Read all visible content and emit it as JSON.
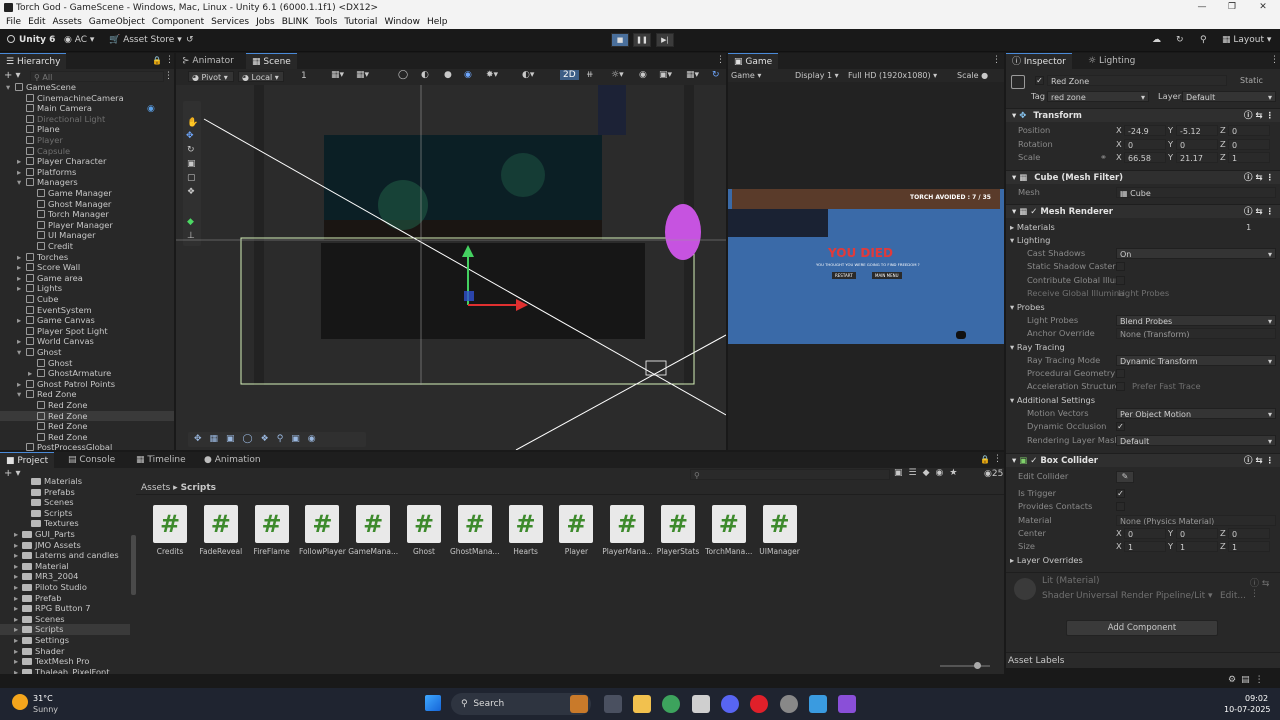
{
  "window": {
    "title": "Torch God - GameScene - Windows, Mac, Linux - Unity 6.1 (6000.1.1f1) <DX12>"
  },
  "menu": [
    "File",
    "Edit",
    "Assets",
    "GameObject",
    "Component",
    "Services",
    "Jobs",
    "BLINK",
    "Tools",
    "Tutorial",
    "Window",
    "Help"
  ],
  "toolbar": {
    "unity": "Unity 6",
    "account": "AC",
    "asset_store": "Asset Store",
    "layout": "Layout"
  },
  "hierarchy": {
    "title": "Hierarchy",
    "search_placeholder": "All",
    "items": [
      {
        "label": "GameScene",
        "depth": 0,
        "style": "scene",
        "arrow": "open"
      },
      {
        "label": "CinemachineCamera",
        "depth": 1
      },
      {
        "label": "Main Camera",
        "depth": 1
      },
      {
        "label": "Directional Light",
        "depth": 1,
        "style": "dim"
      },
      {
        "label": "Plane",
        "depth": 1
      },
      {
        "label": "Player",
        "depth": 1,
        "style": "dim"
      },
      {
        "label": "Capsule",
        "depth": 1,
        "style": "dim"
      },
      {
        "label": "Player Character",
        "depth": 1,
        "arrow": "closed"
      },
      {
        "label": "Platforms",
        "depth": 1,
        "arrow": "closed"
      },
      {
        "label": "Managers",
        "depth": 1,
        "arrow": "open"
      },
      {
        "label": "Game Manager",
        "depth": 2
      },
      {
        "label": "Ghost Manager",
        "depth": 2
      },
      {
        "label": "Torch Manager",
        "depth": 2
      },
      {
        "label": "Player Manager",
        "depth": 2
      },
      {
        "label": "UI Manager",
        "depth": 2
      },
      {
        "label": "Credit",
        "depth": 2
      },
      {
        "label": "Torches",
        "depth": 1,
        "arrow": "closed"
      },
      {
        "label": "Score Wall",
        "depth": 1,
        "arrow": "closed"
      },
      {
        "label": "Game area",
        "depth": 1,
        "arrow": "closed"
      },
      {
        "label": "Lights",
        "depth": 1,
        "arrow": "closed"
      },
      {
        "label": "Cube",
        "depth": 1
      },
      {
        "label": "EventSystem",
        "depth": 1
      },
      {
        "label": "Game Canvas",
        "depth": 1,
        "arrow": "closed"
      },
      {
        "label": "Player Spot Light",
        "depth": 1
      },
      {
        "label": "World Canvas",
        "depth": 1,
        "arrow": "closed"
      },
      {
        "label": "Ghost",
        "depth": 1,
        "arrow": "open"
      },
      {
        "label": "Ghost",
        "depth": 2
      },
      {
        "label": "GhostArmature",
        "depth": 2,
        "arrow": "closed"
      },
      {
        "label": "Ghost Patrol Points",
        "depth": 1,
        "arrow": "closed"
      },
      {
        "label": "Red Zone",
        "depth": 1,
        "arrow": "open"
      },
      {
        "label": "Red Zone",
        "depth": 2
      },
      {
        "label": "Red Zone",
        "depth": 2,
        "style": "sel"
      },
      {
        "label": "Red Zone",
        "depth": 2
      },
      {
        "label": "Red Zone",
        "depth": 2
      },
      {
        "label": "PostProcessGlobal",
        "depth": 1
      }
    ]
  },
  "scene": {
    "tabs": [
      "Animator",
      "Scene"
    ],
    "pivot": "Pivot",
    "local": "Local",
    "snap": "1",
    "mode2d": "2D"
  },
  "game": {
    "tab": "Game",
    "display_mode": "Game",
    "display": "Display 1",
    "resolution": "Full HD (1920x1080)",
    "scale": "Scale",
    "hud": "TORCH AVOIDED : 7 / 35",
    "died_title": "YOU DIED",
    "died_sub": "YOU THOUGHT YOU WERE GOING TO FIND FREEDOM ?",
    "restart": "RESTART",
    "main_menu": "MAIN MENU"
  },
  "inspector": {
    "tabs": [
      "Inspector",
      "Lighting"
    ],
    "name": "Red Zone",
    "static": "Static",
    "tag_label": "Tag",
    "tag": "red zone",
    "layer_label": "Layer",
    "layer": "Default",
    "transform": {
      "title": "Transform",
      "position": [
        "-24.9",
        "-5.12",
        "0"
      ],
      "rotation": [
        "0",
        "0",
        "0"
      ],
      "scale": [
        "66.58",
        "21.17",
        "1"
      ],
      "labels": [
        "Position",
        "Rotation",
        "Scale"
      ]
    },
    "mesh_filter": {
      "title": "Cube (Mesh Filter)",
      "mesh_label": "Mesh",
      "mesh": "Cube"
    },
    "mesh_renderer": {
      "title": "Mesh Renderer",
      "materials": "Materials",
      "materials_count": "1",
      "lighting": "Lighting",
      "cast_shadows_label": "Cast Shadows",
      "cast_shadows": "On",
      "static_shadow": "Static Shadow Caster",
      "contribute_gi": "Contribute Global Illum",
      "receive_gi_label": "Receive Global Illumina",
      "receive_gi": "Light Probes",
      "probes": "Probes",
      "light_probes_label": "Light Probes",
      "light_probes": "Blend Probes",
      "anchor_label": "Anchor Override",
      "anchor": "None (Transform)",
      "ray_tracing": "Ray Tracing",
      "rt_mode_label": "Ray Tracing Mode",
      "rt_mode": "Dynamic Transform",
      "procedural": "Procedural Geometry",
      "accel_label": "Acceleration Structure",
      "accel": "Prefer Fast Trace",
      "additional": "Additional Settings",
      "motion_label": "Motion Vectors",
      "motion": "Per Object Motion",
      "dyn_occ": "Dynamic Occlusion",
      "rlm_label": "Rendering Layer Mask",
      "rlm": "Default"
    },
    "box_collider": {
      "title": "Box Collider",
      "edit": "Edit Collider",
      "is_trigger": "Is Trigger",
      "provides": "Provides Contacts",
      "material_label": "Material",
      "material": "None (Physics Material)",
      "center_label": "Center",
      "center": [
        "0",
        "0",
        "0"
      ],
      "size_label": "Size",
      "size": [
        "1",
        "1",
        "1"
      ],
      "overrides": "Layer Overrides"
    },
    "material": {
      "name": "Lit (Material)",
      "shader_label": "Shader",
      "shader": "Universal Render Pipeline/Lit",
      "edit": "Edit..."
    },
    "add_component": "Add Component",
    "asset_labels": "Asset Labels"
  },
  "bottom": {
    "tabs": [
      "Project",
      "Console",
      "Timeline",
      "Animation"
    ],
    "breadcrumb": [
      "Assets",
      "Scripts"
    ],
    "count": "25",
    "folders": [
      {
        "label": "Materials",
        "depth": 2
      },
      {
        "label": "Prefabs",
        "depth": 2
      },
      {
        "label": "Scenes",
        "depth": 2
      },
      {
        "label": "Scripts",
        "depth": 2
      },
      {
        "label": "Textures",
        "depth": 2
      },
      {
        "label": "GUI_Parts",
        "depth": 1
      },
      {
        "label": "JMO Assets",
        "depth": 1
      },
      {
        "label": "Laterns and candles",
        "depth": 1
      },
      {
        "label": "Material",
        "depth": 1
      },
      {
        "label": "MR3_2004",
        "depth": 1
      },
      {
        "label": "Piloto Studio",
        "depth": 1
      },
      {
        "label": "Prefab",
        "depth": 1
      },
      {
        "label": "RPG Button 7",
        "depth": 1
      },
      {
        "label": "Scenes",
        "depth": 1
      },
      {
        "label": "Scripts",
        "depth": 1,
        "sel": true
      },
      {
        "label": "Settings",
        "depth": 1
      },
      {
        "label": "Shader",
        "depth": 1
      },
      {
        "label": "TextMesh Pro",
        "depth": 1
      },
      {
        "label": "Thaleah_PixelFont",
        "depth": 1
      }
    ],
    "scripts": [
      "Credits",
      "FadeReveal",
      "FireFlame",
      "FollowPlayer",
      "GameMana...",
      "Ghost",
      "GhostMana...",
      "Hearts",
      "Player",
      "PlayerMana...",
      "PlayerStats",
      "TorchMana...",
      "UIManager"
    ]
  },
  "taskbar": {
    "temp": "31°C",
    "weather": "Sunny",
    "search": "Search",
    "time": "09:02",
    "date": "10-07-2025"
  },
  "colors": {
    "accent": "#4a8ad8",
    "bg": "#191919",
    "panel": "#282828"
  }
}
